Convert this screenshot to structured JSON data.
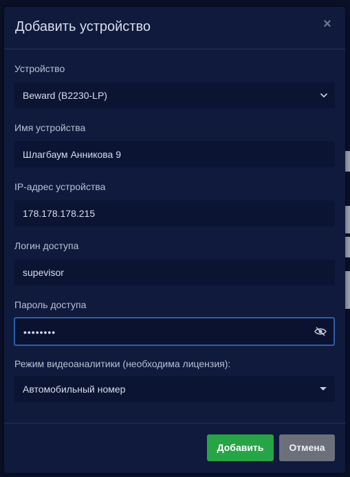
{
  "dialog": {
    "title": "Добавить устройство",
    "close_label": "×"
  },
  "fields": {
    "device": {
      "label": "Устройство",
      "value": "Beward (B2230-LP)"
    },
    "device_name": {
      "label": "Имя устройства",
      "value": "Шлагбаум Анникова 9"
    },
    "ip_address": {
      "label": "IP-адрес устройства",
      "value": "178.178.178.215"
    },
    "login": {
      "label": "Логин доступа",
      "value": "supevisor"
    },
    "password": {
      "label": "Пароль доступа",
      "value": "••••••••"
    },
    "analytics_mode": {
      "label": "Режим видеоаналитики (необходима лицензия):",
      "value": "Автомобильный номер"
    }
  },
  "footer": {
    "add_label": "Добавить",
    "cancel_label": "Отмена"
  },
  "colors": {
    "accent": "#2c60b0",
    "primary_button": "#27a546",
    "secondary_button": "#6c707b",
    "modal_bg": "#0f1a3d"
  },
  "icons": {
    "device_select": "chevron-down-icon",
    "password_toggle": "eye-slash-icon",
    "analytics_select": "caret-down-icon",
    "close": "close-icon"
  }
}
